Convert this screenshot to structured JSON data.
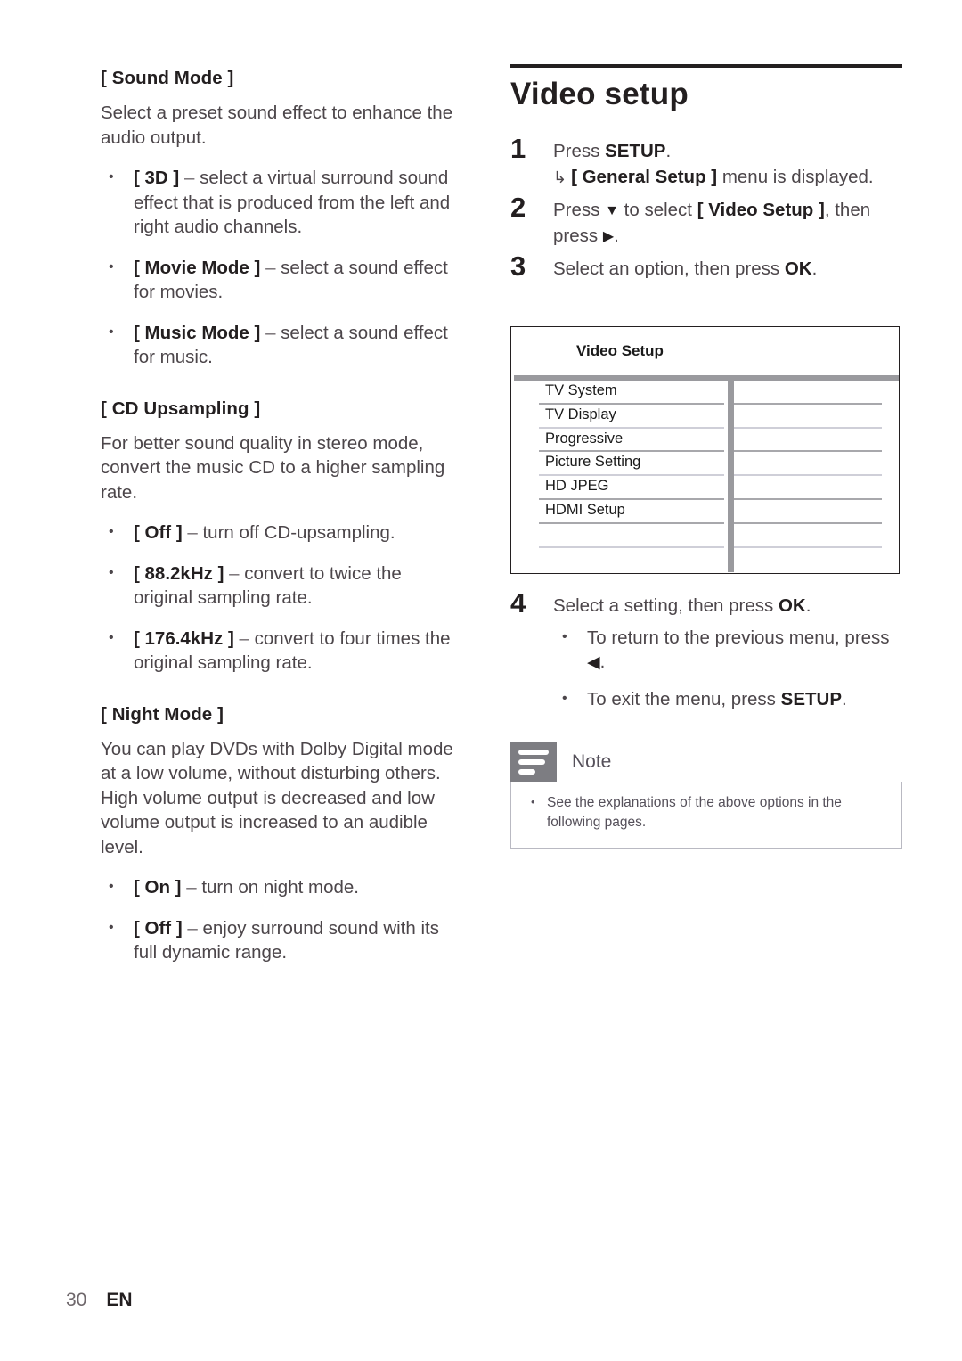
{
  "page": {
    "number": "30",
    "language": "EN"
  },
  "left_column": {
    "sections": [
      {
        "heading": "[ Sound Mode ]",
        "paragraph": "Select a preset sound effect to enhance the audio output.",
        "bullets": [
          {
            "term": "[ 3D ]",
            "dash": "–",
            "text": "select a virtual surround sound effect that is produced from the left and right audio channels."
          },
          {
            "term": "[ Movie Mode ]",
            "dash": "–",
            "text": "select a sound effect for movies."
          },
          {
            "term": "[ Music Mode ]",
            "dash": "–",
            "text": "select a sound effect for music."
          }
        ]
      },
      {
        "heading": "[ CD Upsampling ]",
        "paragraph": "For better sound quality in stereo mode, convert the music CD to a higher sampling rate.",
        "bullets": [
          {
            "term": "[ Off ]",
            "dash": "–",
            "text": "turn off CD-upsampling."
          },
          {
            "term": "[ 88.2kHz ]",
            "dash": "–",
            "text": "convert to twice the original sampling rate."
          },
          {
            "term": "[ 176.4kHz ]",
            "dash": "–",
            "text": "convert to four times the original sampling rate."
          }
        ]
      },
      {
        "heading": "[ Night Mode ]",
        "paragraph": "You can play DVDs with Dolby Digital mode at a low volume, without disturbing others. High volume output is decreased and low volume output is increased to an audible level.",
        "bullets": [
          {
            "term": "[ On ]",
            "dash": "–",
            "text": "turn on night mode."
          },
          {
            "term": "[ Off ]",
            "dash": "–",
            "text": "enjoy surround sound with its full dynamic range."
          }
        ]
      }
    ]
  },
  "right_column": {
    "chapter_title": "Video setup",
    "steps": [
      {
        "number": "1",
        "text_before": "Press ",
        "bold": "SETUP",
        "text_after": ".",
        "result_hook": "↳",
        "result_bold": "[ General Setup ]",
        "result_text": " menu is displayed."
      },
      {
        "number": "2",
        "text_before": "Press ",
        "glyph": "▼",
        "text_mid": " to select ",
        "bold": "[ Video Setup ]",
        "text_after": ", then press ",
        "glyph2": "▶",
        "text_end": "."
      },
      {
        "number": "3",
        "text_before": "Select an option, then press ",
        "bold": "OK",
        "text_after": "."
      },
      {
        "number": "4",
        "text_before": "Select a setting, then press ",
        "bold": "OK",
        "text_after": ".",
        "sub_bullets": [
          {
            "text_before": "To return to the previous menu, press ",
            "glyph": "◀",
            "text_after": "."
          },
          {
            "text_before": "To exit the menu, press ",
            "bold": "SETUP",
            "text_after": "."
          }
        ]
      }
    ],
    "osd_screen": {
      "title": "Video Setup",
      "rows": [
        {
          "label": "TV System",
          "faint": false
        },
        {
          "label": "TV Display",
          "faint": true
        },
        {
          "label": "Progressive",
          "faint": false
        },
        {
          "label": "Picture Setting",
          "faint": true
        },
        {
          "label": "HD JPEG",
          "faint": false
        },
        {
          "label": "HDMI Setup",
          "faint": false
        },
        {
          "label": "",
          "faint": true
        },
        {
          "label": "",
          "faint": false
        }
      ]
    },
    "note": {
      "icon": "note-lines-icon",
      "label": "Note",
      "items": [
        "See the explanations of the above options in the following pages."
      ]
    }
  },
  "colors": {
    "heading": "#231f20",
    "body": "#4c464a",
    "osd_divider": "#9a9a9e",
    "note_icon_bg": "#7d7d82",
    "note_border": "#b9b9c2"
  }
}
